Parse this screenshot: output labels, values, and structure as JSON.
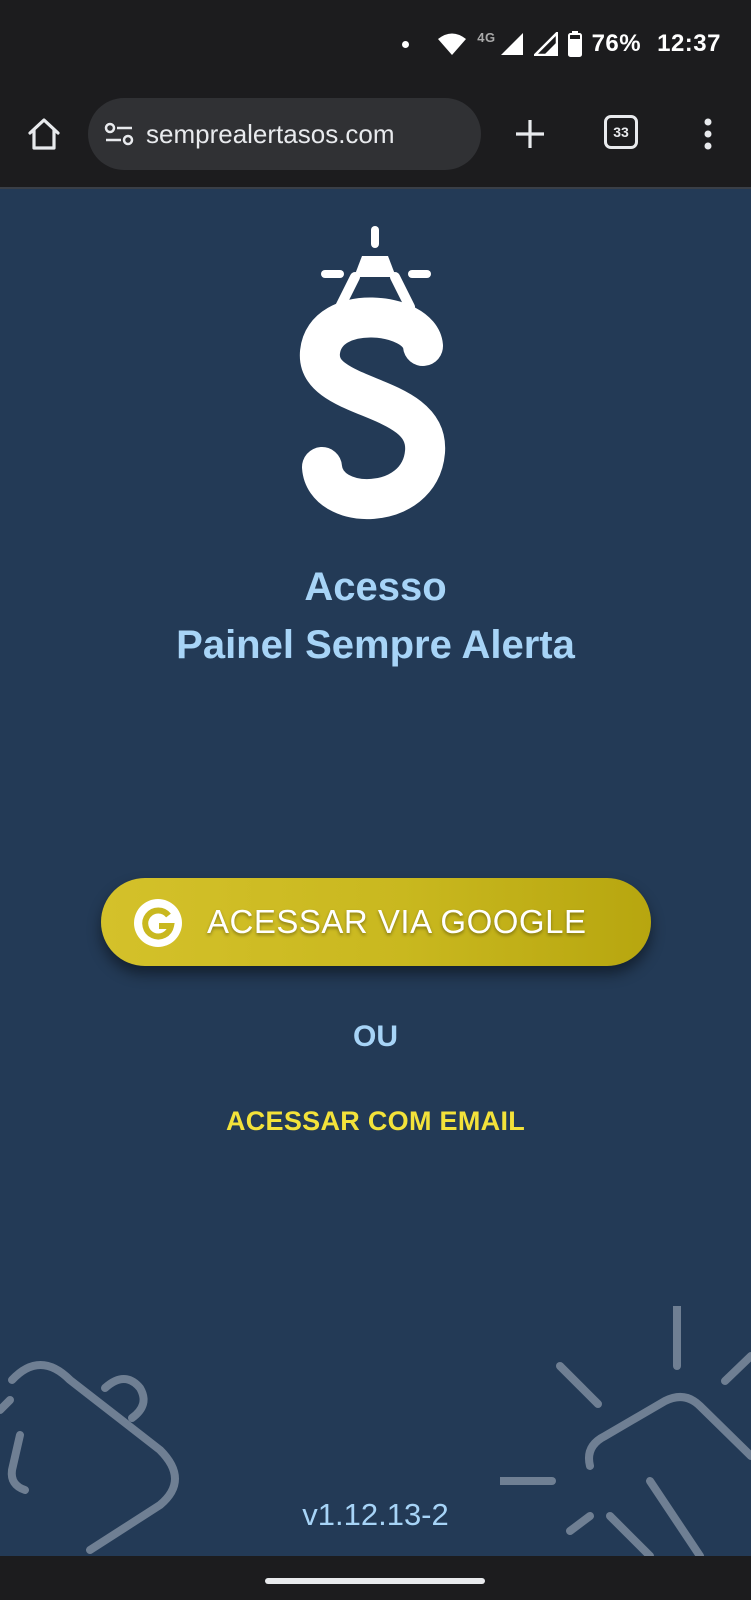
{
  "status_bar": {
    "network": "4G",
    "battery": "76%",
    "time": "12:37",
    "icons": [
      "notification-dot-icon",
      "wifi-icon",
      "signal-icon",
      "signal-icon",
      "battery-icon"
    ]
  },
  "browser": {
    "url": "semprealertasos.com",
    "tab_count": "33",
    "icons": [
      "home-icon",
      "site-settings-icon",
      "new-tab-plus-icon",
      "tabs-icon",
      "more-vert-icon"
    ]
  },
  "main": {
    "logo_icon": "sempre-alerta-logo-icon",
    "title_line1": "Acesso",
    "title_line2": "Painel Sempre Alerta",
    "google_button_label": "ACESSAR VIA GOOGLE",
    "google_icon": "google-g-icon",
    "or_text": "OU",
    "email_link_label": "ACESSAR COM EMAIL",
    "version": "v1.12.13-2"
  },
  "colors": {
    "background": "#233a56",
    "title": "#a7d4f7",
    "google_button": "#c9b81f",
    "email_link": "#f3e23a",
    "chrome_bar": "#1c1c1e"
  }
}
